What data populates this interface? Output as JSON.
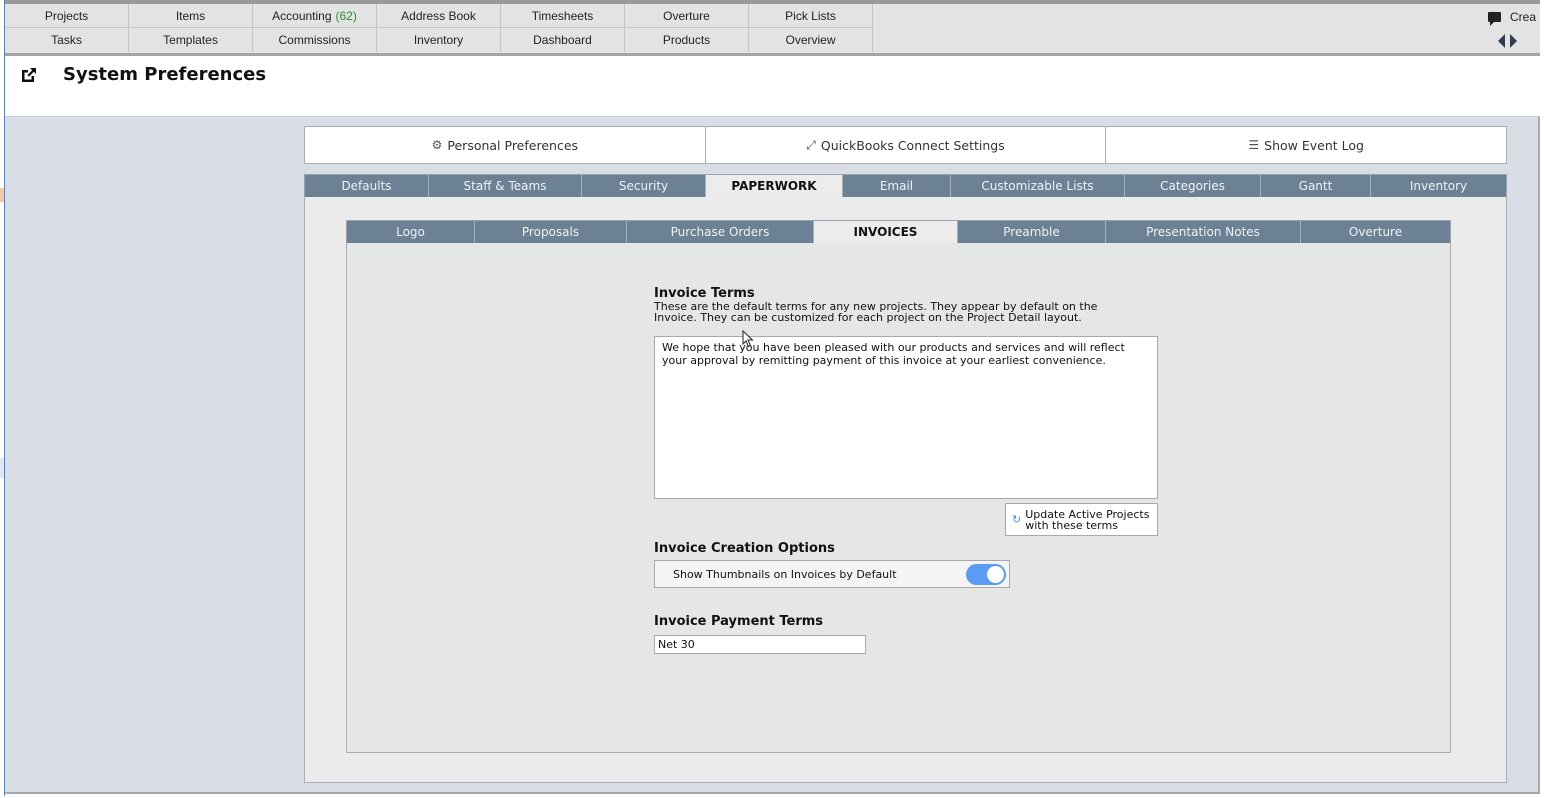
{
  "topnav": {
    "row1": [
      {
        "label": "Projects"
      },
      {
        "label": "Items"
      },
      {
        "label": "Accounting",
        "badge": "(62)"
      },
      {
        "label": "Address Book"
      },
      {
        "label": "Timesheets"
      },
      {
        "label": "Overture"
      },
      {
        "label": "Pick Lists"
      }
    ],
    "row2": [
      {
        "label": "Tasks"
      },
      {
        "label": "Templates"
      },
      {
        "label": "Commissions"
      },
      {
        "label": "Inventory"
      },
      {
        "label": "Dashboard"
      },
      {
        "label": "Products"
      },
      {
        "label": "Overview"
      }
    ],
    "create_label": "Crea",
    "badge_color": "#2e8b2e"
  },
  "header": {
    "title": "System Preferences",
    "icon": "external-link-icon"
  },
  "actions": [
    {
      "label": "Personal Preferences",
      "icon": "gear-icon"
    },
    {
      "label": "QuickBooks Connect Settings",
      "icon": "expand-arrows-icon"
    },
    {
      "label": "Show Event Log",
      "icon": "list-icon"
    }
  ],
  "main_tabs": [
    {
      "label": "Defaults",
      "active": false
    },
    {
      "label": "Staff & Teams",
      "active": false
    },
    {
      "label": "Security",
      "active": false
    },
    {
      "label": "PAPERWORK",
      "active": true
    },
    {
      "label": "Email",
      "active": false
    },
    {
      "label": "Customizable Lists",
      "active": false
    },
    {
      "label": "Categories",
      "active": false
    },
    {
      "label": "Gantt",
      "active": false
    },
    {
      "label": "Inventory",
      "active": false
    }
  ],
  "sub_tabs": [
    {
      "label": "Logo",
      "active": false
    },
    {
      "label": "Proposals",
      "active": false
    },
    {
      "label": "Purchase Orders",
      "active": false
    },
    {
      "label": "INVOICES",
      "active": true
    },
    {
      "label": "Preamble",
      "active": false
    },
    {
      "label": "Presentation Notes",
      "active": false
    },
    {
      "label": "Overture",
      "active": false
    }
  ],
  "invoice_terms": {
    "title": "Invoice Terms",
    "description": "These are the default terms for any new projects. They appear by default on the Invoice.  They can be customized for each project on the Project Detail layout.",
    "value": "We hope that you have been pleased with our products and services and will reflect your approval by remitting payment of this invoice at your earliest convenience.",
    "update_button": "Update Active Projects with these terms"
  },
  "invoice_creation": {
    "title": "Invoice Creation Options",
    "toggle_label": "Show Thumbnails on Invoices by Default",
    "toggle_on": true,
    "toggle_color": "#5b9cf2"
  },
  "payment_terms": {
    "title": "Invoice Payment Terms",
    "value": "Net 30"
  }
}
